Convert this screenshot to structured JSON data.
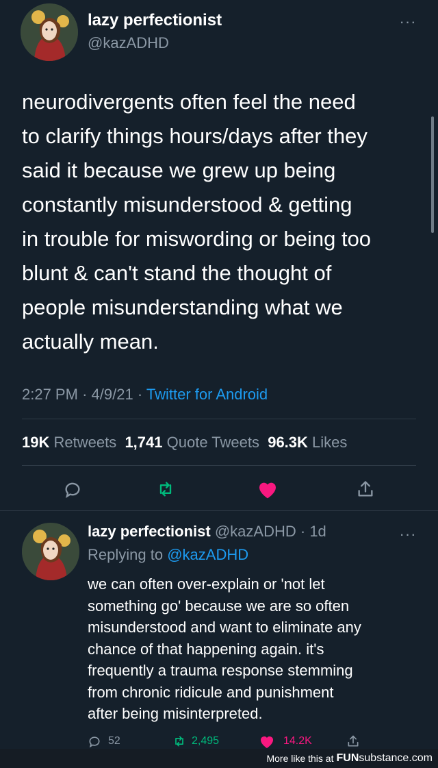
{
  "main_tweet": {
    "display_name": "lazy perfectionist",
    "handle": "@kazADHD",
    "text": "neurodivergents often feel the need\nto clarify things hours/days after they\nsaid it because we grew up being\nconstantly misunderstood & getting\nin trouble for miswording or being too\nblunt & can't stand the thought of\npeople misunderstanding what we\nactually mean.",
    "time": "2:27 PM",
    "sep": "·",
    "date": "4/9/21",
    "source": "Twitter for Android",
    "stats": {
      "retweets_count": "19K",
      "retweets_label": "Retweets",
      "quotes_count": "1,741",
      "quotes_label": "Quote Tweets",
      "likes_count": "96.3K",
      "likes_label": "Likes"
    },
    "more": "···"
  },
  "reply_tweet": {
    "display_name": "lazy perfectionist",
    "handle": "@kazADHD",
    "age": "· 1d",
    "replying_prefix": "Replying to",
    "replying_handle": "@kazADHD",
    "text": "we can often over-explain or 'not let\nsomething go' because we are so often\nmisunderstood and want to eliminate any\nchance of that happening again. it's\nfrequently a trauma response stemming\nfrom chronic ridicule and punishment\nafter being misinterpreted.",
    "reply_count": "52",
    "retweet_count": "2,495",
    "like_count": "14.2K",
    "more": "···"
  },
  "watermark": {
    "prefix": "More like this at",
    "brand_bold": "FUN",
    "brand_rest": "substance",
    "suffix": ".com"
  },
  "colors": {
    "background": "#15202b",
    "accent": "#1d9bf0",
    "retweet_green": "#00ba7c",
    "like_pink": "#f91880",
    "muted": "#8b98a5"
  },
  "icons": [
    "reply-icon",
    "retweet-icon",
    "heart-icon",
    "share-icon",
    "more-icon"
  ]
}
